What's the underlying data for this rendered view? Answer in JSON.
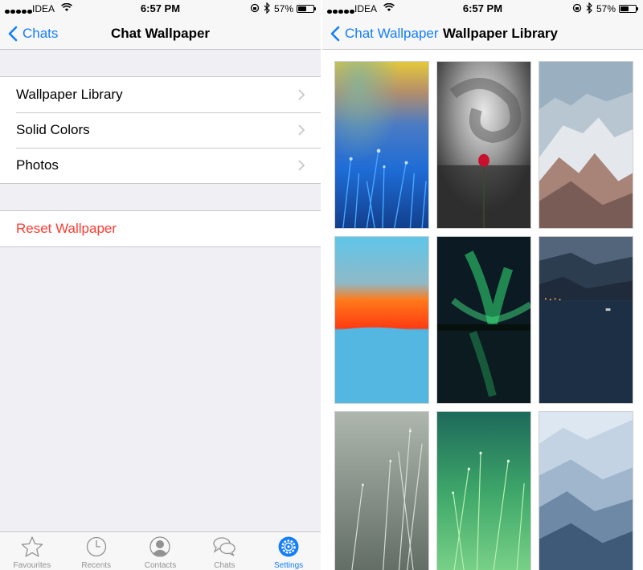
{
  "left": {
    "status": {
      "carrier": "IDEA",
      "time": "6:57 PM",
      "battery": "57%",
      "battery_level": 0.57
    },
    "nav": {
      "back_label": "Chats",
      "title": "Chat Wallpaper"
    },
    "menu": [
      {
        "label": "Wallpaper Library"
      },
      {
        "label": "Solid Colors"
      },
      {
        "label": "Photos"
      }
    ],
    "reset_label": "Reset Wallpaper",
    "colors": {
      "accent": "#147efb",
      "destructive": "#ff3b30"
    },
    "tabs": [
      {
        "label": "Favourites",
        "icon": "star-icon"
      },
      {
        "label": "Recents",
        "icon": "clock-icon"
      },
      {
        "label": "Contacts",
        "icon": "contact-icon"
      },
      {
        "label": "Chats",
        "icon": "chat-bubbles-icon"
      },
      {
        "label": "Settings",
        "icon": "gear-icon",
        "active": true
      }
    ]
  },
  "right": {
    "status": {
      "carrier": "IDEA",
      "time": "6:57 PM",
      "battery": "57%",
      "battery_level": 0.57
    },
    "nav": {
      "back_label": "Chat Wallpaper",
      "title": "Wallpaper Library"
    },
    "wallpapers": [
      {
        "subject": "blue grass with dew drops"
      },
      {
        "subject": "red flower with swirl"
      },
      {
        "subject": "snowy mountain range"
      },
      {
        "subject": "orange red gradient horizon"
      },
      {
        "subject": "aurora over lake"
      },
      {
        "subject": "lake town at dusk"
      },
      {
        "subject": "grey grass close-up"
      },
      {
        "subject": "green grass with dew"
      },
      {
        "subject": "blue misty mountains"
      }
    ]
  }
}
